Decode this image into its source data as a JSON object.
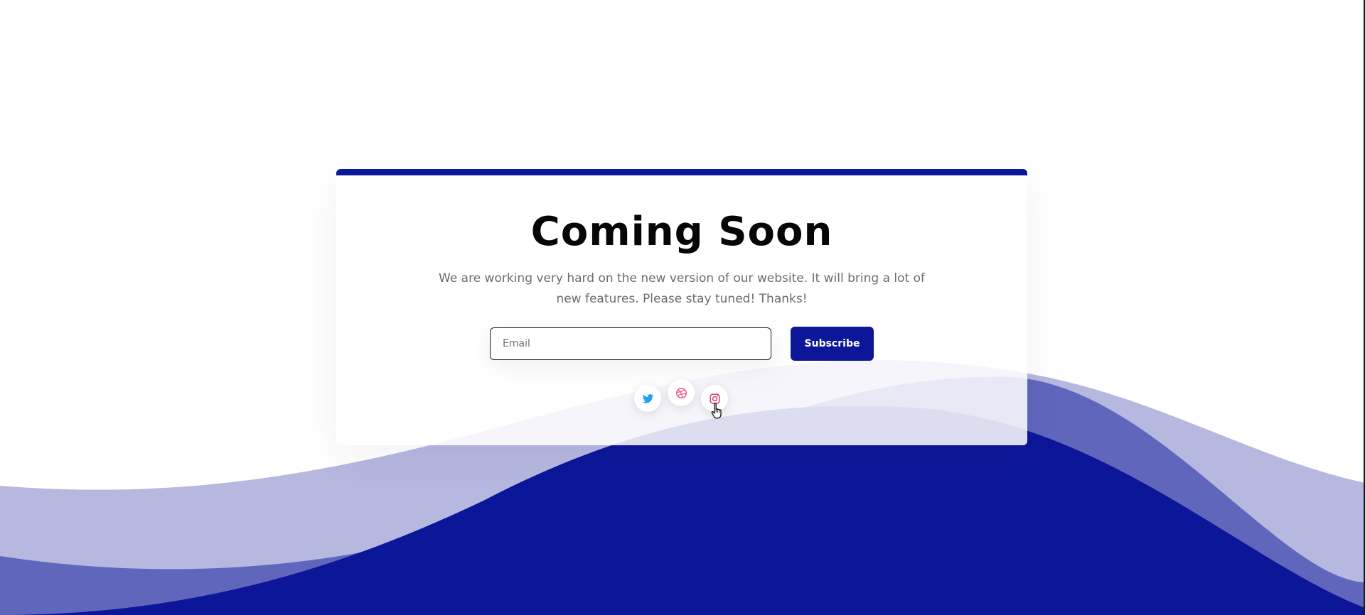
{
  "colors": {
    "accent": "#0c1698",
    "wave_light": "#b6b8e0",
    "wave_mid": "#6166bd",
    "wave_dark": "#0c1698",
    "title": "#060606",
    "subtitle": "#6c6c6c",
    "twitter": "#1da1f2",
    "dribbble": "#ea4c89",
    "instagram": "#e1306c"
  },
  "hero": {
    "title": "Coming Soon",
    "subtitle": "We are working very hard on the new version of our website. It will bring a lot of new features. Please stay tuned! Thanks!"
  },
  "subscribe_form": {
    "email_placeholder": "Email",
    "button_label": "Subscribe"
  },
  "social_links": [
    {
      "icon": "twitter-icon"
    },
    {
      "icon": "dribbble-icon"
    },
    {
      "icon": "instagram-icon"
    }
  ]
}
